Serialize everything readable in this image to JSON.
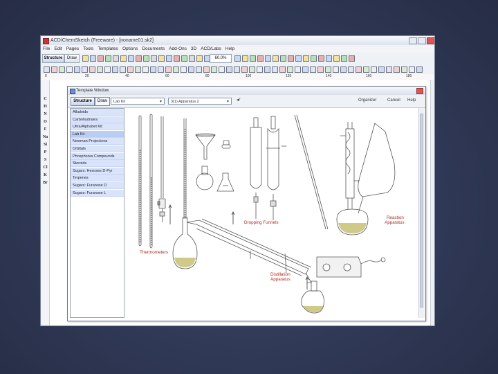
{
  "app": {
    "title": "ACD/ChemSketch (Freeware) - [noname01.sk2]",
    "menu": [
      "File",
      "Edit",
      "Pages",
      "Tools",
      "Templates",
      "Options",
      "Documents",
      "Add-Ons",
      "3D",
      "ACD/Labs",
      "Help"
    ],
    "toolbar": {
      "structure_tab": "Structure",
      "draw_tab": "Draw",
      "zoom_value": "60.0%"
    },
    "ruler_marks": [
      "0",
      "20",
      "40",
      "60",
      "80",
      "100",
      "120",
      "140",
      "160",
      "180"
    ],
    "elements": [
      "C",
      "H",
      "N",
      "O",
      "F",
      "Na",
      "Si",
      "P",
      "S",
      "Cl",
      "K",
      "Br"
    ]
  },
  "template_window": {
    "title": "Template Window",
    "tabs": {
      "structure": "Structure",
      "draw": "Draw"
    },
    "page_dropdown": "Lab Kit",
    "set_dropdown": "3(1) Apparatus 2",
    "links": {
      "organizer": "Organizer",
      "cancel": "Cancel",
      "help": "Help"
    },
    "categories": [
      "Alkaloids",
      "Carbohydrates",
      "Ultra/Alphabet Kit",
      "Lab Kit",
      "Newman Projections",
      "Orbitals",
      "Phosphorus Compounds",
      "Steroids",
      "Sugars: Hexoses D-Pyr",
      "Terpenes",
      "Sugars: Furanose D",
      "Sugars: Furanose L"
    ],
    "selected_category": "Lab Kit",
    "labels": {
      "thermometers": "Thermometers",
      "dropping_funnels": "Dropping Funnels",
      "reaction_apparatus_1": "Reaction",
      "reaction_apparatus_2": "Apparatus",
      "distillation_apparatus_1": "Distillation",
      "distillation_apparatus_2": "Apparatus"
    }
  },
  "colors": {
    "label_red": "#b02a1e",
    "liquid": "#cfc98a",
    "slide_bg": "#2f3855"
  }
}
